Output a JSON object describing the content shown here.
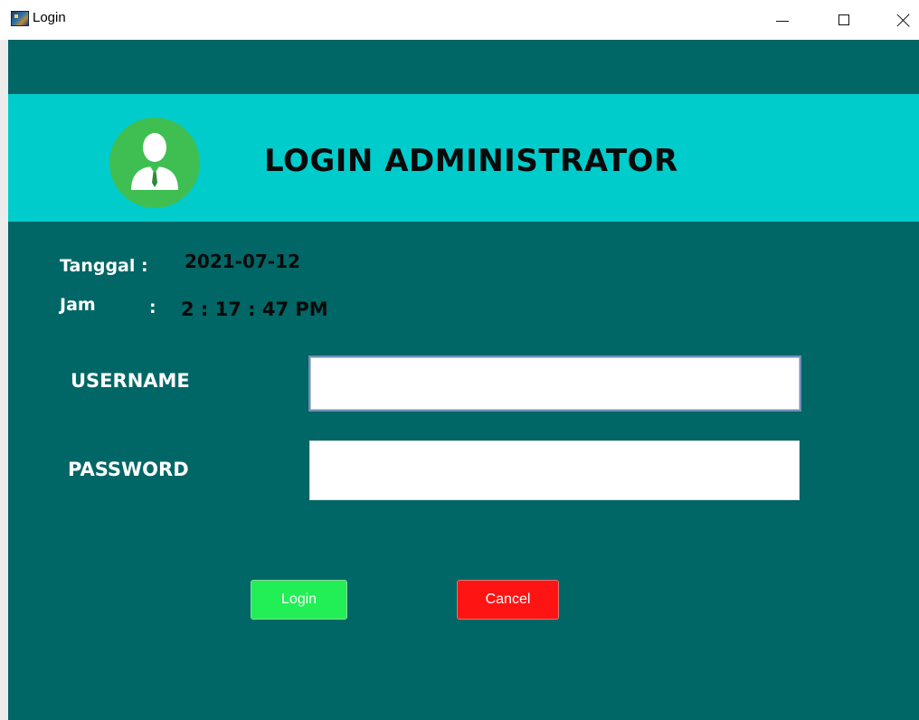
{
  "window": {
    "title": "Login",
    "icon": "app-icon",
    "controls": {
      "minimize": "minimize-icon",
      "maximize": "maximize-icon",
      "close": "close-icon"
    }
  },
  "header": {
    "title": "LOGIN ADMINISTRATOR",
    "avatar_icon": "admin-user-icon"
  },
  "info": {
    "date_label": "Tanggal :",
    "date_value": "2021-07-12",
    "time_label": "Jam",
    "time_colon": ":",
    "time_value": "2 : 17 : 47 PM"
  },
  "form": {
    "username_label": "USERNAME",
    "username_value": "",
    "password_label": "PASSWORD",
    "password_value": ""
  },
  "buttons": {
    "login_label": "Login",
    "cancel_label": "Cancel"
  },
  "colors": {
    "background": "#006666",
    "header_band": "#00cccc",
    "avatar": "#3fbe52",
    "login_button": "#22ee55",
    "cancel_button": "#ff1414"
  }
}
